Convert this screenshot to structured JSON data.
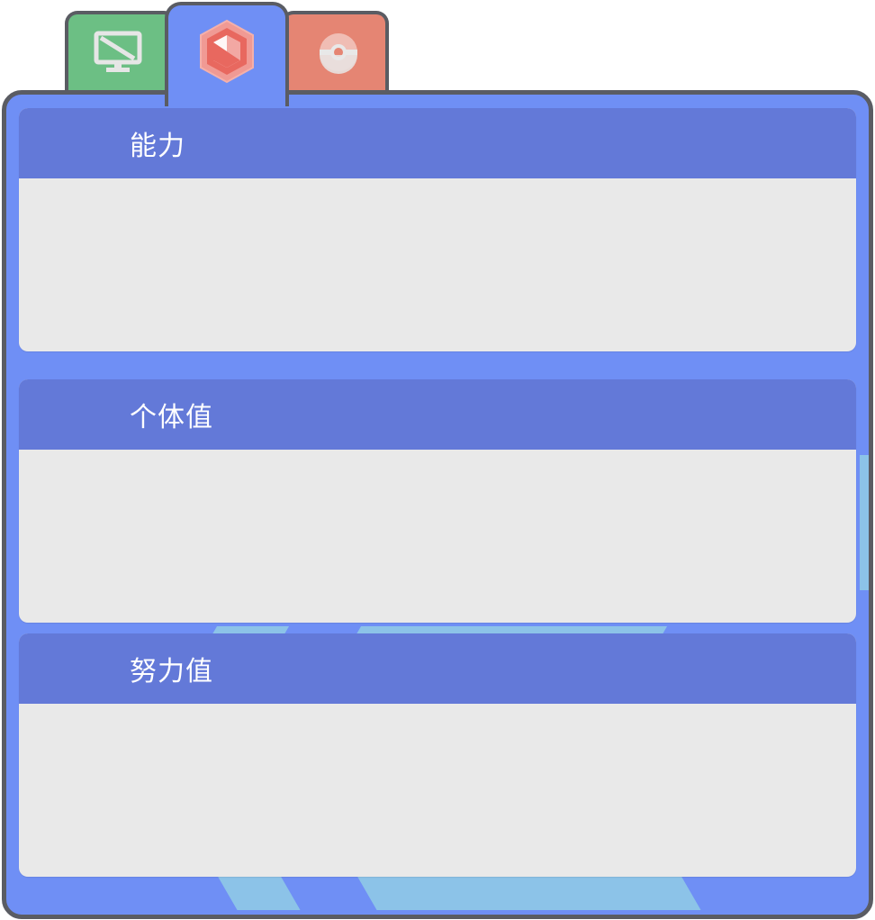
{
  "tabs": [
    {
      "id": "info",
      "icon": "monitor-icon",
      "color": "#6cbf84",
      "active": false
    },
    {
      "id": "stats",
      "icon": "hexagon-chart-icon",
      "color": "#6f8ff5",
      "active": true
    },
    {
      "id": "ball",
      "icon": "pokeball-icon",
      "color": "#e58573",
      "active": false
    }
  ],
  "sections": {
    "ability_title": "能力",
    "iv_title": "个体值",
    "ev_title": "努力值"
  },
  "colors": {
    "panel": "#6f8ff5",
    "header": "#6379d8",
    "card_body": "#e9e9e9",
    "border": "#5a5c63"
  }
}
